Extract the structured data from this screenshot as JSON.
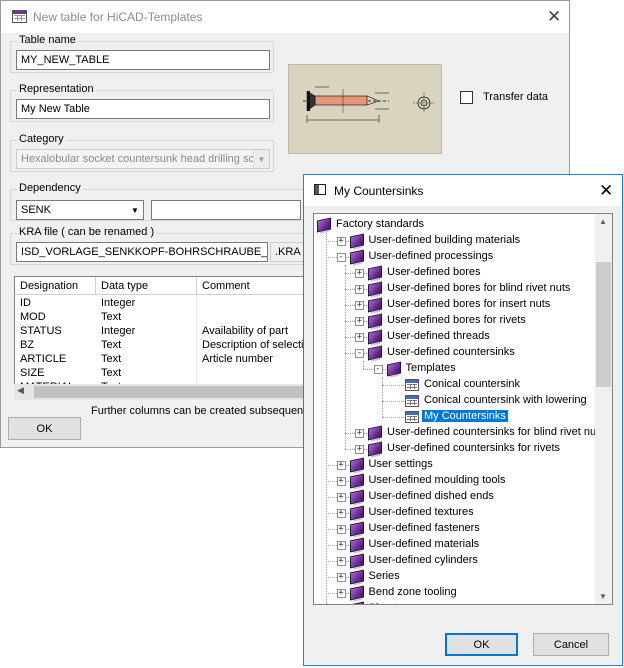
{
  "main_dialog": {
    "title": "New table for HiCAD-Templates",
    "table_name": {
      "label": "Table name",
      "value": "MY_NEW_TABLE"
    },
    "representation": {
      "label": "Representation",
      "value": "My New Table"
    },
    "category": {
      "label": "Category",
      "value": "Hexalobular socket countersunk head drilling scr"
    },
    "dependency": {
      "label": "Dependency",
      "value": "SENK",
      "second_value": ""
    },
    "kra_file": {
      "label": "KRA file ( can be renamed )",
      "value": "ISD_VORLAGE_SENKKOPF-BOHRSCHRAUBE_INNEN",
      "extension": ".KRA"
    },
    "transfer_data": {
      "label": "Transfer data",
      "checked": false
    },
    "columns": {
      "headers": [
        "Designation",
        "Data type",
        "Comment"
      ],
      "rows": [
        {
          "designation": "ID",
          "type": "Integer",
          "comment": ""
        },
        {
          "designation": "MOD",
          "type": "Text",
          "comment": ""
        },
        {
          "designation": "STATUS",
          "type": "Integer",
          "comment": "Availability of part"
        },
        {
          "designation": "BZ",
          "type": "Text",
          "comment": "Description of selection"
        },
        {
          "designation": "ARTICLE",
          "type": "Text",
          "comment": "Article number"
        },
        {
          "designation": "SIZE",
          "type": "Text",
          "comment": ""
        },
        {
          "designation": "MATERIAL",
          "type": "Text",
          "comment": ""
        }
      ]
    },
    "hint": "Further columns can be created subsequently",
    "ok_label": "OK"
  },
  "tree_dialog": {
    "title": "My Countersinks",
    "ok_label": "OK",
    "cancel_label": "Cancel",
    "nodes": [
      {
        "label": "Factory standards",
        "level": 0,
        "expander": "",
        "icon": "book-icon"
      },
      {
        "label": "User-defined building materials",
        "level": 1,
        "expander": "+",
        "icon": "book-icon"
      },
      {
        "label": "User-defined processings",
        "level": 1,
        "expander": "-",
        "icon": "book-icon"
      },
      {
        "label": "User-defined bores",
        "level": 2,
        "expander": "+",
        "icon": "book-icon"
      },
      {
        "label": "User-defined bores for blind rivet nuts",
        "level": 2,
        "expander": "+",
        "icon": "book-icon"
      },
      {
        "label": "User-defined bores for insert nuts",
        "level": 2,
        "expander": "+",
        "icon": "book-icon"
      },
      {
        "label": "User-defined bores for rivets",
        "level": 2,
        "expander": "+",
        "icon": "book-icon"
      },
      {
        "label": "User-defined threads",
        "level": 2,
        "expander": "+",
        "icon": "book-icon"
      },
      {
        "label": "User-defined countersinks",
        "level": 2,
        "expander": "-",
        "icon": "book-icon"
      },
      {
        "label": "Templates",
        "level": 3,
        "expander": "-",
        "icon": "book-icon"
      },
      {
        "label": "Conical countersink",
        "level": 4,
        "expander": "",
        "icon": "table-icon"
      },
      {
        "label": "Conical countersink with lowering",
        "level": 4,
        "expander": "",
        "icon": "table-icon"
      },
      {
        "label": "My Countersinks",
        "level": 4,
        "expander": "",
        "icon": "table-icon",
        "selected": true
      },
      {
        "label": "User-defined countersinks for blind rivet nuts",
        "level": 2,
        "expander": "+",
        "icon": "book-icon"
      },
      {
        "label": "User-defined countersinks for rivets",
        "level": 2,
        "expander": "+",
        "icon": "book-icon"
      },
      {
        "label": "User settings",
        "level": 1,
        "expander": "+",
        "icon": "book-icon"
      },
      {
        "label": "User-defined moulding tools",
        "level": 1,
        "expander": "+",
        "icon": "book-icon"
      },
      {
        "label": "User-defined dished ends",
        "level": 1,
        "expander": "+",
        "icon": "book-icon"
      },
      {
        "label": "User-defined textures",
        "level": 1,
        "expander": "+",
        "icon": "book-icon"
      },
      {
        "label": "User-defined fasteners",
        "level": 1,
        "expander": "+",
        "icon": "book-icon"
      },
      {
        "label": "User-defined materials",
        "level": 1,
        "expander": "+",
        "icon": "book-icon"
      },
      {
        "label": "User-defined cylinders",
        "level": 1,
        "expander": "+",
        "icon": "book-icon"
      },
      {
        "label": "Series",
        "level": 1,
        "expander": "+",
        "icon": "book-icon"
      },
      {
        "label": "Bend zone tooling",
        "level": 1,
        "expander": "+",
        "icon": "book-icon"
      },
      {
        "label": "Sheet ...",
        "level": 1,
        "expander": "+",
        "icon": "book-icon"
      }
    ]
  }
}
